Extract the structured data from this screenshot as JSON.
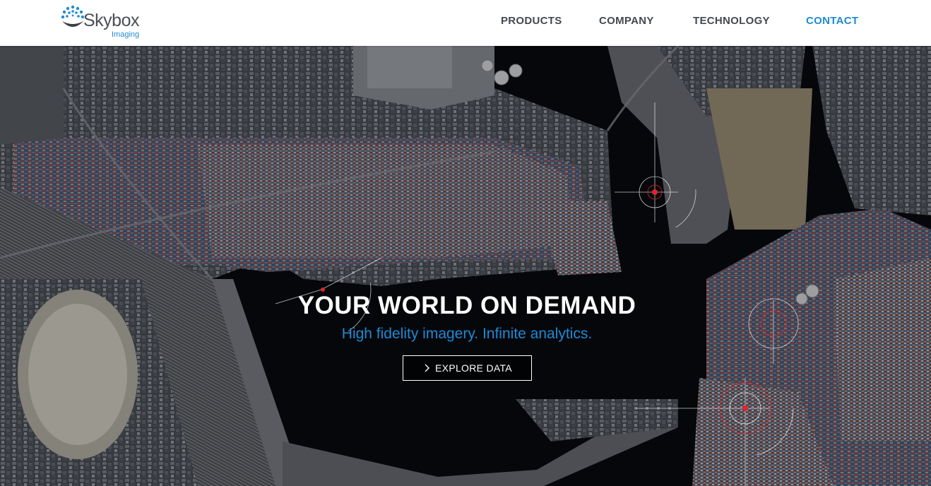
{
  "brand": {
    "name": "Skybox",
    "sub": "Imaging",
    "accent": "#1e8ad6"
  },
  "nav": {
    "items": [
      {
        "label": "PRODUCTS",
        "active": false
      },
      {
        "label": "COMPANY",
        "active": false
      },
      {
        "label": "TECHNOLOGY",
        "active": false
      },
      {
        "label": "CONTACT",
        "active": true
      }
    ]
  },
  "hero": {
    "title": "YOUR WORLD ON DEMAND",
    "subtitle": "High fidelity imagery. Infinite analytics.",
    "cta_label": "EXPLORE DATA",
    "cta_icon": "chevron-right-icon",
    "background": "satellite-port-image"
  }
}
